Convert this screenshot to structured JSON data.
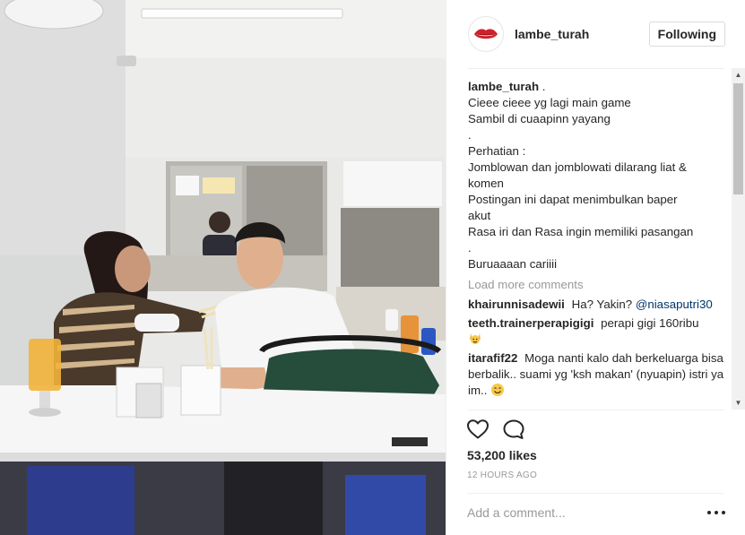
{
  "post": {
    "username": "lambe_turah",
    "follow_label": "Following",
    "caption": {
      "user": "lambe_turah",
      "suffix": " .",
      "lines": [
        "Cieee cieee yg lagi main game",
        "Sambil di cuaapinn yayang",
        ".",
        "Perhatian :",
        "Jomblowan dan jomblowati dilarang liat &",
        "komen",
        "Postingan ini dapat menimbulkan baper",
        "akut",
        "Rasa iri dan Rasa ingin memiliki pasangan",
        ".",
        "Buruaaaan cariiii"
      ]
    },
    "load_more": "Load more comments",
    "comments": [
      {
        "user": "khairunnisadewii",
        "text": "Ha? Yakin?",
        "mention": "@niasaputri30"
      },
      {
        "user": "teeth.trainerperapigigi",
        "text": "perapi gigi 160ribu",
        "emoji": "raised-hands-emoji"
      },
      {
        "user": "itarafif22",
        "text": "Moga nanti kalo dah berkeluarga bisa berbalik.. suami yg 'ksh makan' (nyuapin) istri ya im..",
        "emoji": "smile-emoji"
      }
    ],
    "likes": "53,200 likes",
    "time": "12 HOURS AGO",
    "comment_placeholder": "Add a comment..."
  },
  "colors": {
    "text": "#262626",
    "muted": "#999999",
    "mention": "#003569",
    "border": "#dbdbdb",
    "avatar_lips": "#d0202a"
  },
  "icons": {
    "like": "heart-outline-icon",
    "comment": "speech-bubble-icon",
    "more": "more-options-icon",
    "avatar": "lips-logo"
  }
}
